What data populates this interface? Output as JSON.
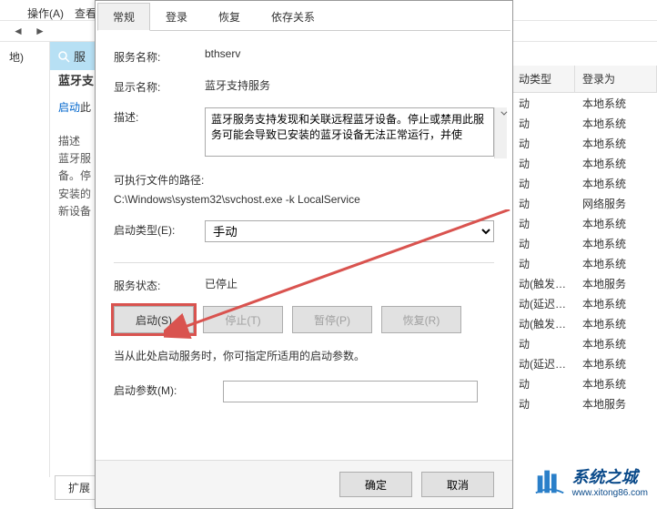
{
  "bg": {
    "menu_action": "操作(A)",
    "menu_view": "查看(",
    "left_item": "地)",
    "search_label": "服",
    "detail_title": "蓝牙支",
    "link_start": "启动",
    "link_after": "此",
    "desc_label": "描述",
    "desc_ln1": "蓝牙服",
    "desc_ln2": "备。停",
    "desc_ln3": "安装的",
    "desc_ln4": "新设备",
    "tab_ext": "扩展",
    "tab_std": ""
  },
  "table": {
    "h_type": "动类型",
    "h_login": "登录为",
    "rows": [
      {
        "type": "动",
        "login": "本地系统"
      },
      {
        "type": "动",
        "login": "本地系统"
      },
      {
        "type": "动",
        "login": "本地系统"
      },
      {
        "type": "动",
        "login": "本地系统"
      },
      {
        "type": "动",
        "login": "本地系统"
      },
      {
        "type": "动",
        "login": "网络服务"
      },
      {
        "type": "动",
        "login": "本地系统"
      },
      {
        "type": "动",
        "login": "本地系统"
      },
      {
        "type": "动",
        "login": "本地系统"
      },
      {
        "type": "动(触发…",
        "login": "本地服务"
      },
      {
        "type": "动(延迟…",
        "login": "本地系统"
      },
      {
        "type": "动(触发…",
        "login": "本地系统"
      },
      {
        "type": "动",
        "login": "本地系统"
      },
      {
        "type": "动(延迟…",
        "login": "本地系统"
      },
      {
        "type": "动",
        "login": "本地系统"
      },
      {
        "type": "动",
        "login": "本地服务"
      }
    ]
  },
  "dialog": {
    "tabs": {
      "general": "常规",
      "logon": "登录",
      "recovery": "恢复",
      "deps": "依存关系"
    },
    "svc_name_lbl": "服务名称:",
    "svc_name_val": "bthserv",
    "disp_name_lbl": "显示名称:",
    "disp_name_val": "蓝牙支持服务",
    "desc_lbl": "描述:",
    "desc_val": "蓝牙服务支持发现和关联远程蓝牙设备。停止或禁用此服务可能会导致已安装的蓝牙设备无法正常运行，并使",
    "path_lbl": "可执行文件的路径:",
    "path_val": "C:\\Windows\\system32\\svchost.exe -k LocalService",
    "startup_lbl": "启动类型(E):",
    "startup_val": "手动",
    "status_lbl": "服务状态:",
    "status_val": "已停止",
    "btn_start": "启动(S)",
    "btn_stop": "停止(T)",
    "btn_pause": "暂停(P)",
    "btn_resume": "恢复(R)",
    "note": "当从此处启动服务时，你可指定所适用的启动参数。",
    "param_lbl": "启动参数(M):",
    "param_val": "",
    "ok": "确定",
    "cancel": "取消"
  },
  "watermark": {
    "cn": "系统之城",
    "en": "www.xitong86.com"
  }
}
